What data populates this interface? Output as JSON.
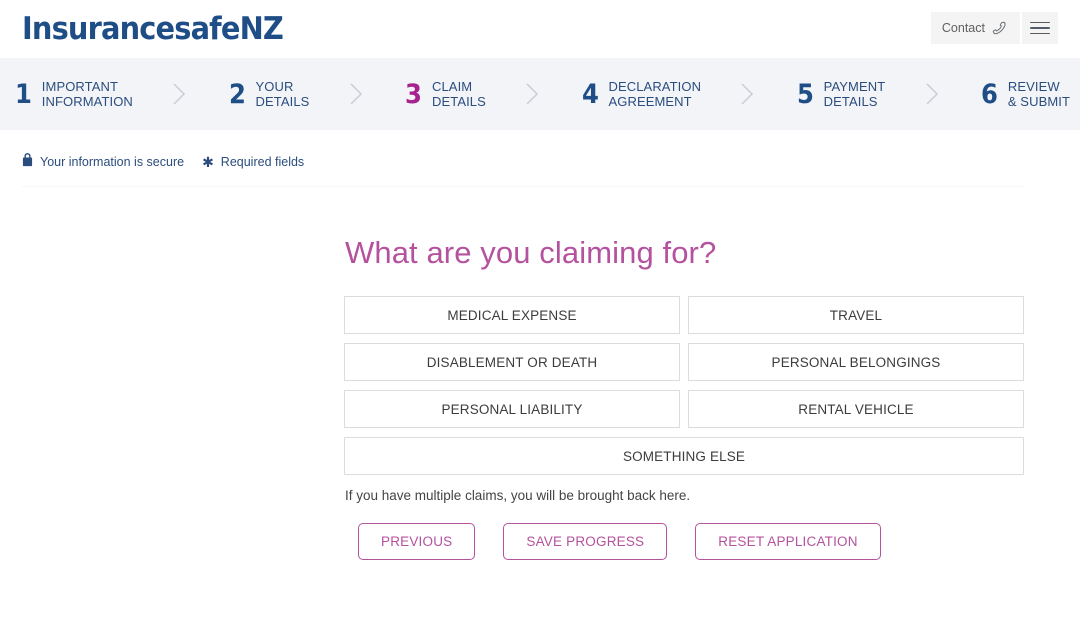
{
  "header": {
    "logo": "InsurancesafeNZ",
    "contact_label": "Contact",
    "phone_icon": "phone-icon",
    "menu_icon": "hamburger-menu-icon"
  },
  "steps": [
    {
      "number": "1",
      "label": "IMPORTANT\nINFORMATION",
      "active": false
    },
    {
      "number": "2",
      "label": "YOUR\nDETAILS",
      "active": false
    },
    {
      "number": "3",
      "label": "CLAIM\nDETAILS",
      "active": true
    },
    {
      "number": "4",
      "label": "DECLARATION\nAGREEMENT",
      "active": false
    },
    {
      "number": "5",
      "label": "PAYMENT\nDETAILS",
      "active": false
    },
    {
      "number": "6",
      "label": "REVIEW\n& SUBMIT",
      "active": false
    }
  ],
  "notices": {
    "secure_text": "Your information is secure",
    "secure_icon": "lock-icon",
    "required_text": "Required fields",
    "required_icon": "asterisk-icon"
  },
  "main": {
    "title": "What are you claiming for?",
    "claim_options": [
      {
        "label": "MEDICAL EXPENSE",
        "full_width": false
      },
      {
        "label": "TRAVEL",
        "full_width": false
      },
      {
        "label": "DISABLEMENT OR DEATH",
        "full_width": false
      },
      {
        "label": "PERSONAL BELONGINGS",
        "full_width": false
      },
      {
        "label": "PERSONAL LIABILITY",
        "full_width": false
      },
      {
        "label": "RENTAL VEHICLE",
        "full_width": false
      },
      {
        "label": "SOMETHING ELSE",
        "full_width": true
      }
    ],
    "helper_text": "If you have multiple claims, you will be brought back here.",
    "actions": [
      {
        "label": "PREVIOUS",
        "name": "previous-button"
      },
      {
        "label": "SAVE PROGRESS",
        "name": "save-progress-button"
      },
      {
        "label": "RESET APPLICATION",
        "name": "reset-application-button"
      }
    ]
  },
  "colors": {
    "navy": "#1f4e87",
    "accent_magenta": "#a6228f",
    "accent_orchid": "#b5529e",
    "stepbar_bg": "#f2f4f8",
    "option_border": "#dcdcdc"
  }
}
